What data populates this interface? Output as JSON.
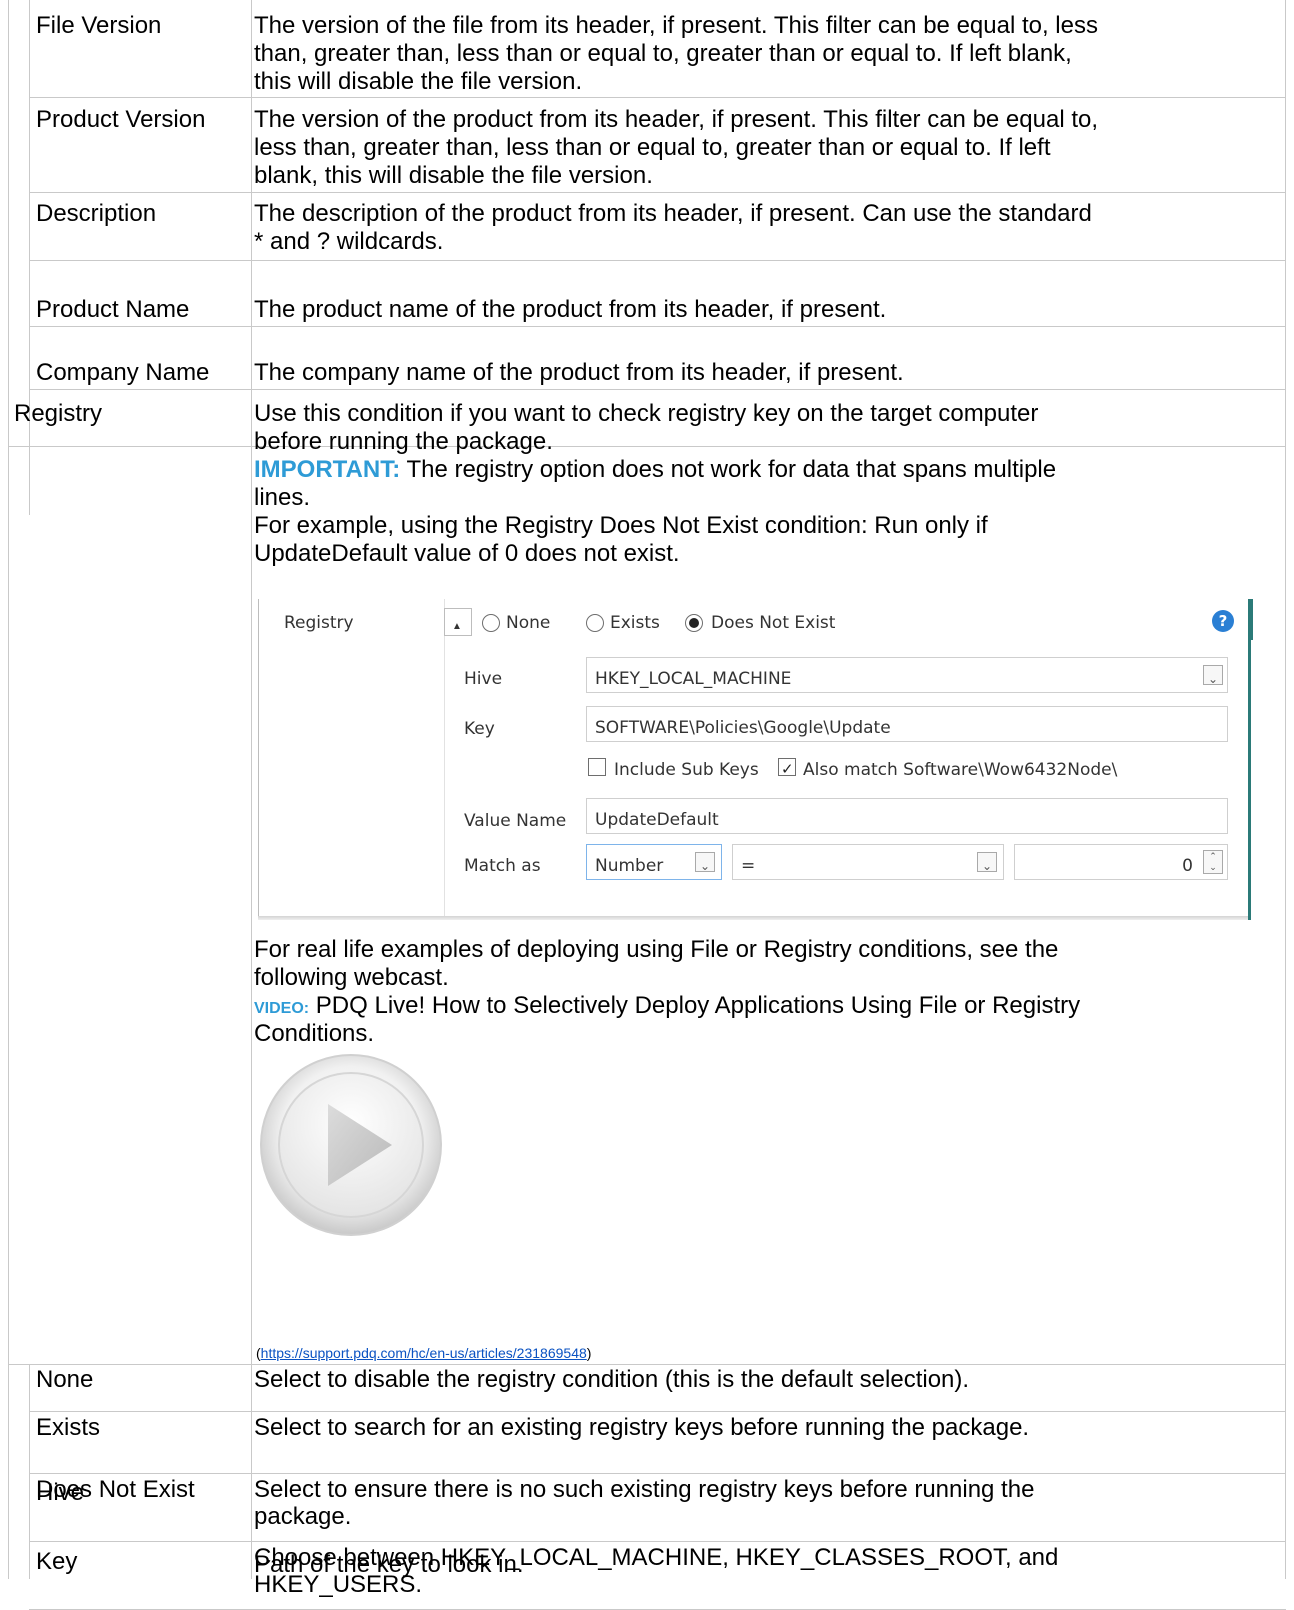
{
  "rows_top": [
    {
      "title": "File Version",
      "desc_lines": [
        "The version of the file from its header, if present. This filter can be equal to, less",
        "than, greater than, less than or equal to, greater than or equal to. If left blank,",
        "this will disable the file version."
      ]
    },
    {
      "title": "Product Version",
      "desc_lines": [
        "The version of the product from its header, if present. This filter can be equal to,",
        "less than, greater than, less than or equal to, greater than or equal to. If left",
        "blank, this will disable the file version."
      ]
    },
    {
      "title": "Description",
      "desc_lines": [
        "The description of the product from its header, if present. Can use the standard",
        "* and ? wildcards."
      ]
    },
    {
      "title": "Product Name",
      "desc_lines": [
        "The product name of the product from its header, if present."
      ]
    },
    {
      "title": "Company Name",
      "desc_lines": [
        "The company name of the product from its header, if present."
      ]
    }
  ],
  "registry": {
    "title": "Registry",
    "intro_lines": [
      "Use this condition if you want to check registry key on the target computer",
      "before running the package."
    ],
    "important_label": "IMPORTANT:",
    "important_line1": " The registry option does not work for data that spans multiple",
    "important_line2": "lines.",
    "example_lines": [
      "For example, using the Registry Does Not Exist condition: Run only if",
      "UpdateDefault value of 0 does not exist."
    ],
    "screenshot": {
      "label": "Registry",
      "collapse_glyph": "▲",
      "radio_none": "None",
      "radio_exists": "Exists",
      "radio_does_not_exist": "Does Not Exist",
      "selected_radio": "Does Not Exist",
      "help_glyph": "?",
      "hive_label": "Hive",
      "hive_value": "HKEY_LOCAL_MACHINE",
      "key_label": "Key",
      "key_value": "SOFTWARE\\Policies\\Google\\Update",
      "include_sub_keys": "Include Sub Keys",
      "include_sub_keys_checked": false,
      "also_match": "Also match Software\\Wow6432Node\\",
      "also_match_checked": true,
      "value_name_label": "Value Name",
      "value_name_value": "UpdateDefault",
      "match_as_label": "Match as",
      "match_type": "Number",
      "match_operator": "=",
      "match_value": "0"
    },
    "real_life_lines": [
      "For real life examples of deploying using File or Registry conditions, see the",
      "following webcast."
    ],
    "video_label": "VIDEO:",
    "video_line1": " PDQ Live! How to Selectively Deploy Applications Using File or Registry",
    "video_line2": "Conditions.",
    "link_open": "(",
    "link_url": "https://support.pdq.com/hc/en-us/articles/231869548",
    "link_close": ")"
  },
  "rows_bottom": [
    {
      "title": "None",
      "desc_lines": [
        "Select to disable the registry condition (this is the default selection)."
      ]
    },
    {
      "title": "Exists",
      "desc_lines": [
        "Select to search for an existing registry keys before running the package."
      ]
    },
    {
      "title": "Does Not Exist",
      "desc_lines": [
        "Select to ensure there is no such existing registry keys before running the",
        "package."
      ]
    },
    {
      "title": "Hive",
      "desc_lines": [
        "Choose between HKEY_LOCAL_MACHINE, HKEY_CLASSES_ROOT, and",
        "HKEY_USERS."
      ]
    },
    {
      "title": "Key",
      "desc_lines": [
        "Path of the key to look in."
      ]
    }
  ]
}
